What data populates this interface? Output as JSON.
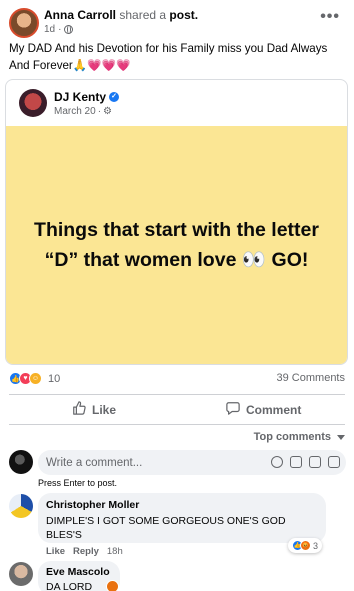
{
  "post": {
    "author": "Anna Carroll",
    "verb": "shared a",
    "object": "post.",
    "time": "1d",
    "more_icon": "more-dots-icon",
    "text": "My DAD And his Devotion for his Family miss you Dad Always And Forever🙏💗💗💗"
  },
  "shared": {
    "author": "DJ Kenty",
    "date": "March 20",
    "quote": "Things that start with the letter “D” that women love 👀 GO!",
    "background_color": "#fbe694"
  },
  "engagement": {
    "reaction_count": "10",
    "comments_count": "39 Comments",
    "like_label": "Like",
    "comment_label": "Comment",
    "sort_label": "Top comments"
  },
  "composer": {
    "placeholder": "Write a comment...",
    "hint": "Press Enter to post."
  },
  "comments": [
    {
      "author": "Christopher Moller",
      "text": "DIMPLE'S I GOT SOME GORGEOUS ONE'S GOD BLES'S",
      "like": "Like",
      "reply": "Reply",
      "time": "18h",
      "reaction_count": "3"
    },
    {
      "author": "Eve Mascolo",
      "text": "DA LORD"
    }
  ]
}
